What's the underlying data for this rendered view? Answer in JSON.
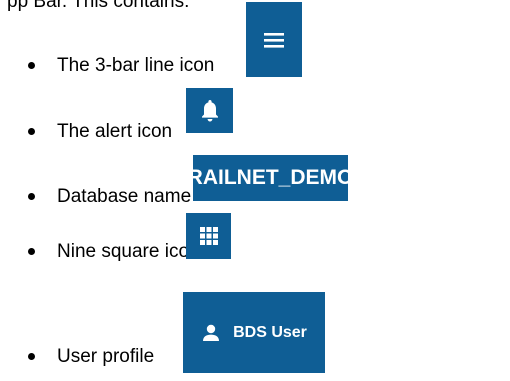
{
  "intro_text": "pp Bar. This contains:",
  "bullets": [
    {
      "text": "The 3-bar line icon",
      "icon": "menu-icon"
    },
    {
      "text": "The alert icon",
      "icon": "bell-icon"
    },
    {
      "text": "Database name",
      "tile_label": "RAILNET_DEMO"
    },
    {
      "text": "Nine square icon",
      "icon": "grid-icon"
    },
    {
      "text": "User profile",
      "icon": "user-icon",
      "tile_label": "BDS User"
    }
  ],
  "colors": {
    "tile_background": "#0f5e95",
    "tile_foreground": "#ffffff",
    "text": "#000000"
  }
}
